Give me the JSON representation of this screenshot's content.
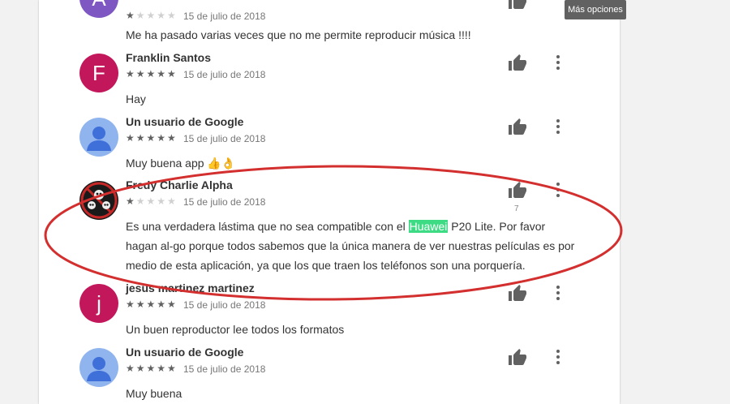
{
  "tooltip": {
    "text": "Más opciones"
  },
  "reviews": [
    {
      "initial": "A",
      "avatar_color": "#7e57c2",
      "name": "",
      "rating": 1,
      "date": "15 de julio de 2018",
      "text_before": "Me ha pasado varias veces que no me permite reproducir música !!!!",
      "highlight": "",
      "text_after": "",
      "likes": ""
    },
    {
      "initial": "F",
      "avatar_color": "#c2185b",
      "name": "Franklin Santos",
      "rating": 5,
      "date": "15 de julio de 2018",
      "text_before": "Hay",
      "highlight": "",
      "text_after": "",
      "likes": ""
    },
    {
      "initial": "",
      "avatar_color": "#90b4ee",
      "name": "Un usuario de Google",
      "rating": 5,
      "date": "15 de julio de 2018",
      "text_before": "Muy buena app 👍👌",
      "highlight": "",
      "text_after": "",
      "likes": ""
    },
    {
      "initial": "",
      "avatar_color": "#1a1a1a",
      "name": "Fredy Charlie Alpha",
      "rating": 1,
      "date": "15 de julio de 2018",
      "text_before": "Es una verdadera lástima que no sea compatible con el ",
      "highlight": "Huawei",
      "text_after": " P20 Lite. Por favor hagan al-go porque todos sabemos que la única manera de ver nuestras películas es por medio de esta aplicación, ya que los que traen los teléfonos son una porquería.",
      "likes": "7"
    },
    {
      "initial": "j",
      "avatar_color": "#c2185b",
      "name": "jesus martinez martinez",
      "rating": 5,
      "date": "15 de julio de 2018",
      "text_before": "Un buen reproductor lee todos los formatos",
      "highlight": "",
      "text_after": "",
      "likes": ""
    },
    {
      "initial": "",
      "avatar_color": "#90b4ee",
      "name": "Un usuario de Google",
      "rating": 5,
      "date": "15 de julio de 2018",
      "text_before": "Muy buena",
      "highlight": "",
      "text_after": "",
      "likes": ""
    }
  ]
}
